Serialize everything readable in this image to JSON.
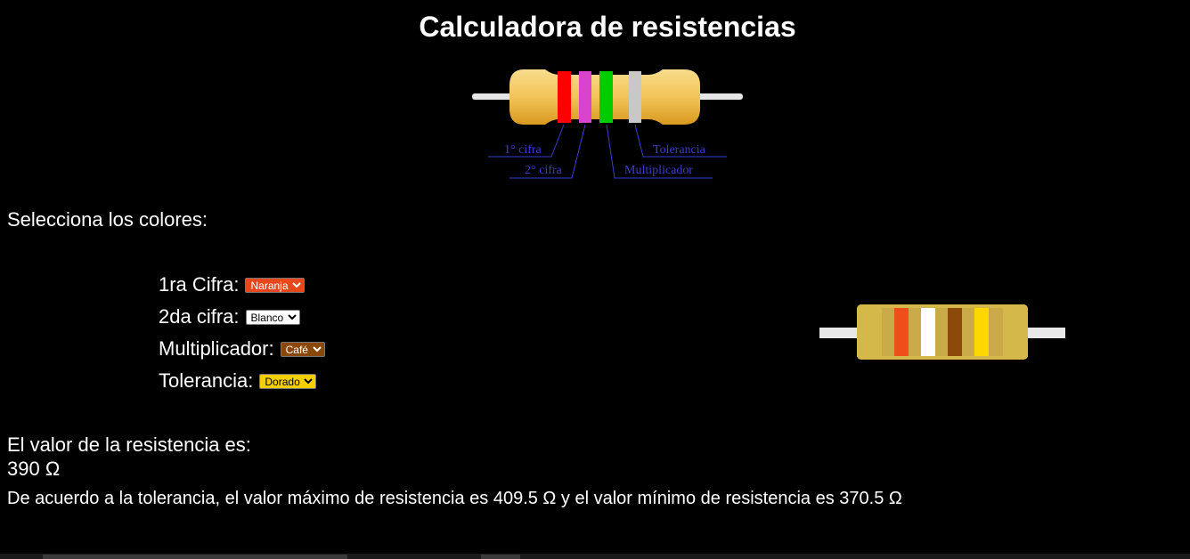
{
  "page": {
    "title": "Calculadora de resistencias",
    "section_label": "Selecciona los colores:"
  },
  "diagram": {
    "labels": {
      "digit1": "1° cifra",
      "digit2": "2° cifra",
      "multiplier": "Multiplicador",
      "tolerance": "Tolerancia"
    },
    "band_colors": [
      "#ff0000",
      "#d844cc",
      "#00cc00",
      "#c8c8c8"
    ],
    "body_color": "#f2c458",
    "label_color": "#3c3cd0"
  },
  "form": {
    "digit1": {
      "label": "1ra Cifra:",
      "value": "Naranja",
      "color": "#e8471b"
    },
    "digit2": {
      "label": "2da cifra:",
      "value": "Blanco",
      "color": "#ffffff"
    },
    "multiplier": {
      "label": "Multiplicador:",
      "value": "Café",
      "color": "#8a4708"
    },
    "tolerance": {
      "label": "Tolerancia:",
      "value": "Dorado",
      "color": "#f5d000"
    }
  },
  "resistor": {
    "body_color": "#d4b84a",
    "lead_color": "#e8e8e8",
    "band_colors": [
      "#ee4e1c",
      "#ffffff",
      "#8b4a0a",
      "#ffd700"
    ]
  },
  "result": {
    "label": "El valor de la resistencia es:",
    "value": "390 Ω",
    "range_text": "De acuerdo a la tolerancia, el valor máximo de resistencia es 409.5 Ω y el valor mínimo de resistencia es 370.5 Ω"
  }
}
